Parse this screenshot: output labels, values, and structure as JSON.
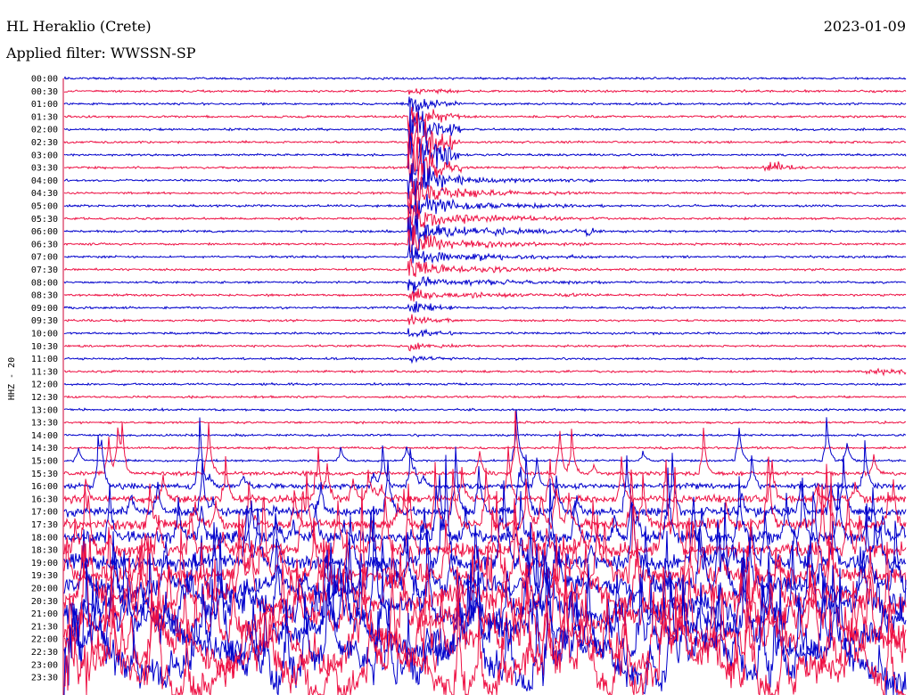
{
  "header": {
    "station": "HL Heraklio (Crete)",
    "date": "2023-01-09",
    "filter": "Applied filter: WWSSN-SP"
  },
  "chart_data": {
    "type": "line",
    "title": "HL Heraklio (Crete)",
    "subtitle": "Applied filter: WWSSN-SP",
    "ylabel": "HHZ - 20",
    "xlabel": "",
    "tick_labels": [
      "00:00",
      "00:30",
      "01:00",
      "01:30",
      "02:00",
      "02:30",
      "03:00",
      "03:30",
      "04:00",
      "04:30",
      "05:00",
      "05:30",
      "06:00",
      "06:30",
      "07:00",
      "07:30",
      "08:00",
      "08:30",
      "09:00",
      "09:30",
      "10:00",
      "10:30",
      "11:00",
      "11:30",
      "12:00",
      "12:30",
      "13:00",
      "13:30",
      "14:00",
      "14:30",
      "15:00",
      "15:30",
      "16:00",
      "16:30",
      "17:00",
      "17:30",
      "18:00",
      "18:30",
      "19:00",
      "19:30",
      "20:00",
      "20:30",
      "21:00",
      "21:30",
      "22:00",
      "22:30",
      "23:00",
      "23:30"
    ],
    "trace_colors": [
      "#0000cc",
      "#ee1144"
    ],
    "grid": false,
    "events": [
      {
        "trace": "01:00",
        "x_minutes": 10.7,
        "note": "large earthquake onset, strong coda through ~11:00"
      },
      {
        "trace": "03:30",
        "x_minutes": 22.0,
        "note": "local event"
      },
      {
        "trace": "06:00",
        "x_minutes": 16.5,
        "note": "small event"
      },
      {
        "trace": "11:30",
        "x_minutes": 27.5,
        "note": "small event"
      },
      {
        "trace": "23:30",
        "x_minutes": 0.5,
        "note": "event onset"
      }
    ],
    "noise_increase_from": "15:30"
  }
}
